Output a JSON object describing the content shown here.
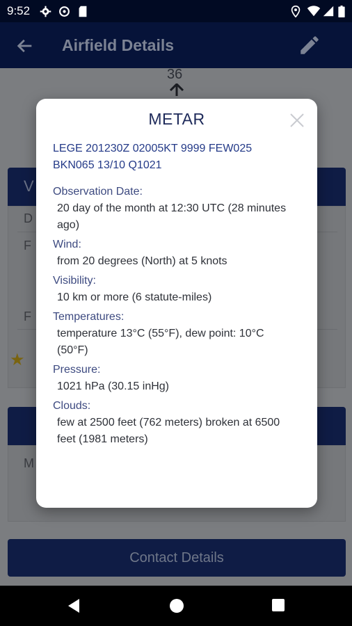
{
  "status_bar": {
    "time": "9:52",
    "icons": [
      "gear-icon",
      "data-saver-icon",
      "sd-card-icon",
      "location-icon",
      "wifi-icon",
      "cell-signal-icon",
      "battery-icon"
    ]
  },
  "app_bar": {
    "title": "Airfield Details",
    "back_icon": "arrow-left-icon",
    "edit_icon": "pencil-icon"
  },
  "background": {
    "runway_number": "36",
    "contact_button": "Contact Details",
    "accent": "#061339"
  },
  "dialog": {
    "title": "METAR",
    "raw": "LEGE 201230Z 02005KT 9999 FEW025 BKN065 13/10 Q1021",
    "fields": [
      {
        "label": "Observation Date:",
        "value": "20 day of the month at 12:30 UTC (28 minutes ago)"
      },
      {
        "label": "Wind:",
        "value": "from 20 degrees (North) at 5 knots"
      },
      {
        "label": "Visibility:",
        "value": "10 km or more (6 statute-miles)"
      },
      {
        "label": "Temperatures:",
        "value": "temperature 13°C (55°F), dew point: 10°C (50°F)"
      },
      {
        "label": "Pressure:",
        "value": "1021 hPa (30.15 inHg)"
      },
      {
        "label": "Clouds:",
        "value": "few at 2500 feet (762 meters) broken at 6500 feet (1981 meters)"
      }
    ]
  },
  "nav_bar": {
    "icons": [
      "back-triangle-icon",
      "home-circle-icon",
      "recents-square-icon"
    ]
  }
}
